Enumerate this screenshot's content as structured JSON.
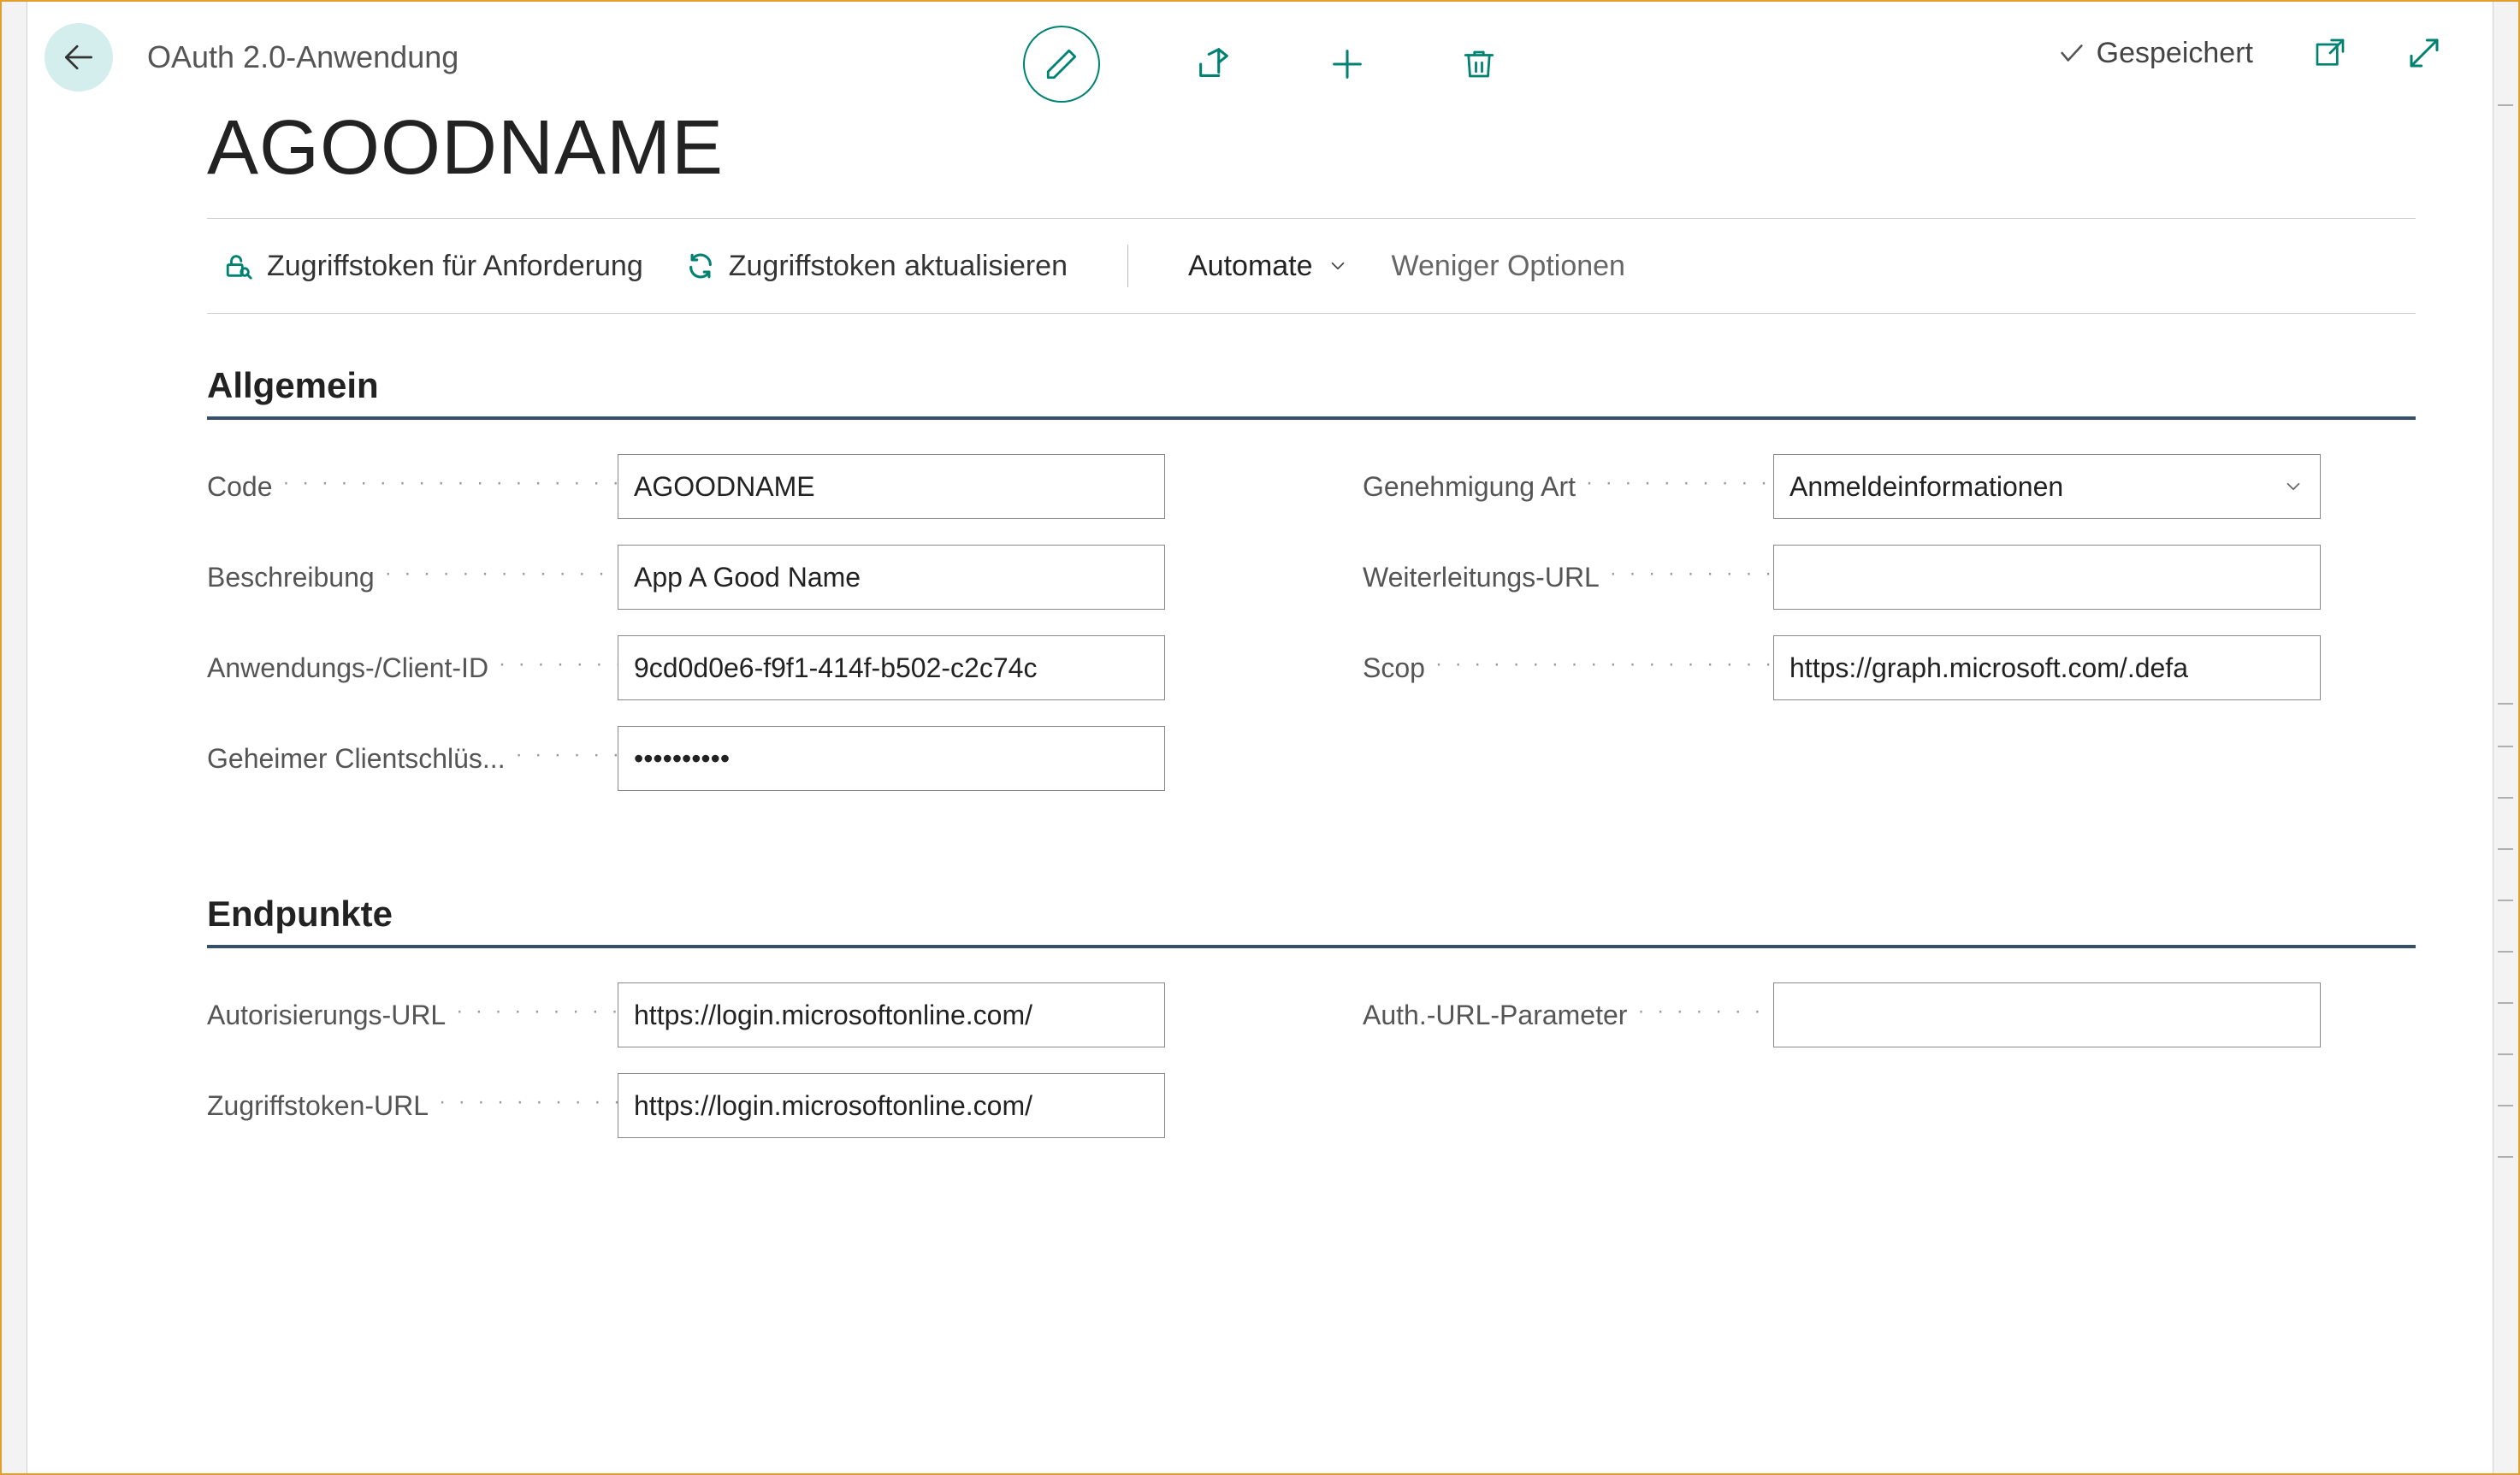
{
  "header": {
    "page_type": "OAuth 2.0-Anwendung",
    "saved_label": "Gespeichert"
  },
  "title": "AGOODNAME",
  "actions": {
    "request_token": "Zugriffstoken für Anforderung",
    "refresh_token": "Zugriffstoken aktualisieren",
    "automate": "Automate",
    "fewer_options": "Weniger Optionen"
  },
  "sections": {
    "general": {
      "heading": "Allgemein",
      "fields": {
        "code": {
          "label": "Code",
          "value": "AGOODNAME"
        },
        "description": {
          "label": "Beschreibung",
          "value": "App A Good Name"
        },
        "client_id": {
          "label": "Anwendungs-/Client-ID",
          "value": "9cd0d0e6-f9f1-414f-b502-c2c74c"
        },
        "client_secret": {
          "label": "Geheimer Clientschlüs...",
          "value": "••••••••••"
        },
        "grant_type": {
          "label": "Genehmigung Art",
          "value": "Anmeldeinformationen"
        },
        "redirect_url": {
          "label": "Weiterleitungs-URL",
          "value": ""
        },
        "scope": {
          "label": "Scop",
          "value": "https://graph.microsoft.com/.defa"
        }
      }
    },
    "endpoints": {
      "heading": "Endpunkte",
      "fields": {
        "auth_url": {
          "label": "Autorisierungs-URL",
          "value": "https://login.microsoftonline.com/"
        },
        "token_url": {
          "label": "Zugriffstoken-URL",
          "value": "https://login.microsoftonline.com/"
        },
        "auth_url_params": {
          "label": "Auth.-URL-Parameter",
          "value": ""
        }
      }
    }
  }
}
